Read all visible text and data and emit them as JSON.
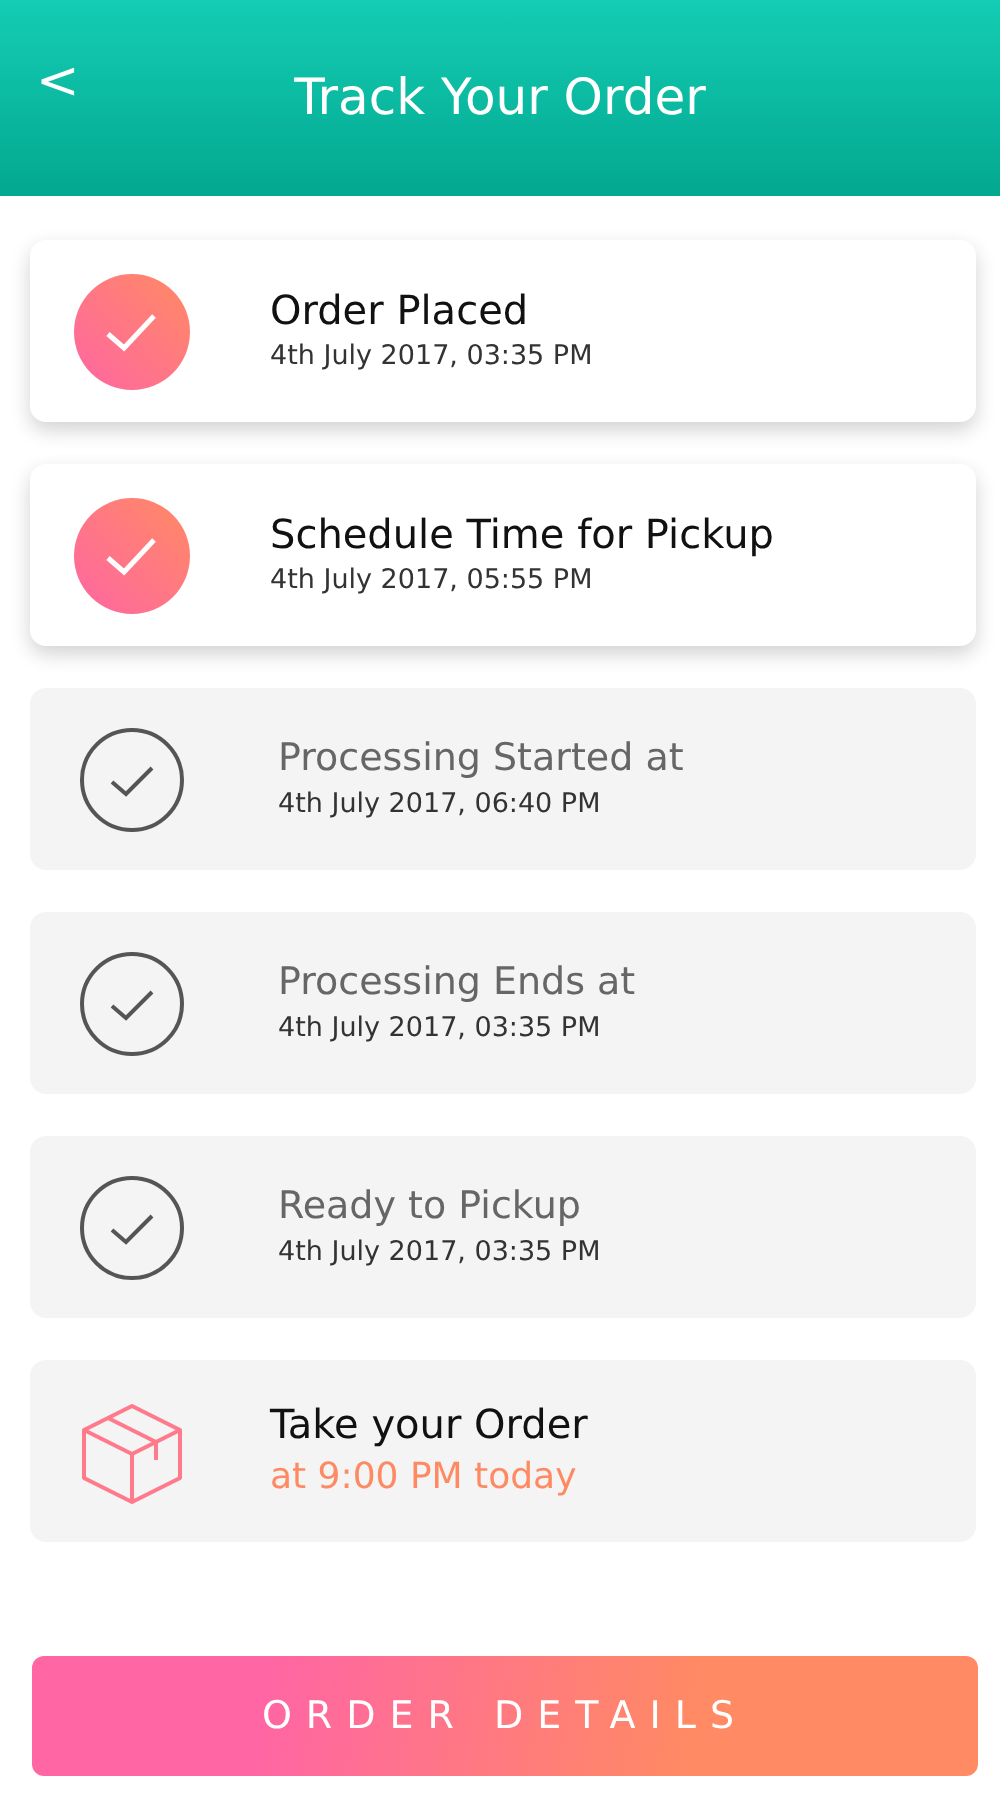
{
  "header": {
    "back": "<",
    "title": "Track Your Order"
  },
  "steps": [
    {
      "kind": "done",
      "title": "Order Placed",
      "subtitle": "4th July 2017, 03:35 PM"
    },
    {
      "kind": "done",
      "title": "Schedule Time for Pickup",
      "subtitle": "4th July 2017, 05:55 PM"
    },
    {
      "kind": "pending",
      "title": "Processing Started at",
      "subtitle": "4th July 2017, 06:40 PM"
    },
    {
      "kind": "pending",
      "title": "Processing Ends at",
      "subtitle": "4th July 2017, 03:35 PM"
    },
    {
      "kind": "pending",
      "title": "Ready to Pickup",
      "subtitle": "4th July 2017, 03:35 PM"
    },
    {
      "kind": "pickup",
      "title": "Take your Order",
      "subtitle": "at 9:00 PM today"
    }
  ],
  "button": "ORDER DETAILS"
}
